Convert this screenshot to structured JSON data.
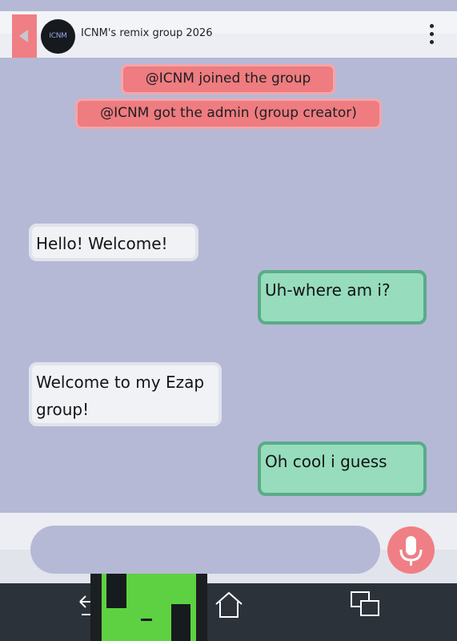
{
  "header": {
    "title": "ICNM's remix group 2026",
    "avatar_text": "ICNM"
  },
  "system_messages": [
    "@ICNM joined the group",
    "@ICNM got the admin (group creator)"
  ],
  "messages": [
    {
      "side": "incoming",
      "text": "Hello! Welcome!"
    },
    {
      "side": "outgoing",
      "text": "Uh-where am i?"
    },
    {
      "side": "incoming",
      "text": "Welcome to my Ezap group!"
    },
    {
      "side": "outgoing",
      "text": "Oh cool i guess"
    }
  ],
  "composer": {
    "value": "",
    "placeholder": ""
  },
  "icons": {
    "back": "back-arrow-icon",
    "menu": "more-vertical-icon",
    "mic": "microphone-icon",
    "nav_back": "nav-back-icon",
    "nav_home": "nav-home-icon",
    "nav_recent": "nav-recent-apps-icon"
  },
  "colors": {
    "background": "#b5b9d6",
    "accent": "#ef7f84",
    "incoming_bubble": "#f1f2f6",
    "outgoing_bubble": "#96dcbd",
    "outgoing_border": "#5aab8a",
    "navbar": "#2c323a"
  }
}
